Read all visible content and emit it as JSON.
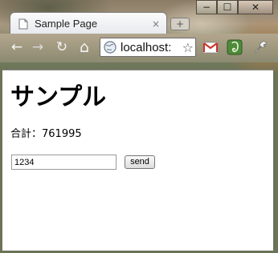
{
  "window": {
    "controls": {
      "minimize": "−",
      "maximize": "☐",
      "close": "✕"
    }
  },
  "tab": {
    "title": "Sample Page",
    "close": "×",
    "new_tab": "+"
  },
  "toolbar": {
    "back": "←",
    "forward": "→",
    "reload": "↻",
    "home": "⌂",
    "url": "localhost:",
    "bookmark_star": "☆",
    "wrench": "🔧"
  },
  "page": {
    "heading": "サンプル",
    "total_text": "合計：761995",
    "input_value": "1234",
    "send_label": "send"
  },
  "colors": {
    "content_bg": "#ffffff",
    "frame_tint": "#8a7c66"
  }
}
